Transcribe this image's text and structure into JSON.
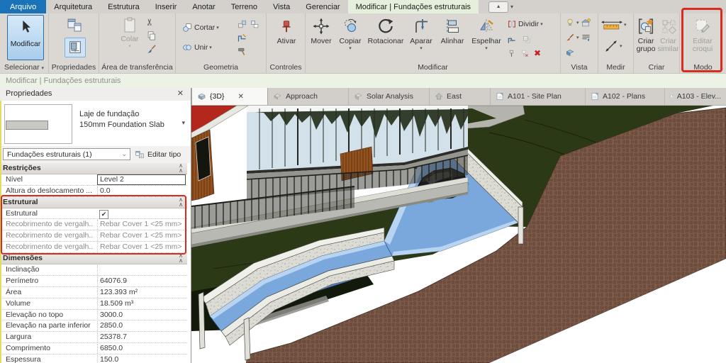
{
  "menu": {
    "items": [
      "Arquivo",
      "Arquitetura",
      "Estrutura",
      "Inserir",
      "Anotar",
      "Terreno",
      "Vista",
      "Gerenciar"
    ],
    "context_tab": "Modificar | Fundações estruturais"
  },
  "ribbon": {
    "modify_button": "Modificar",
    "panel_select": "Selecionar",
    "panel_properties": "Propriedades",
    "panel_clipboard": "Área de transferência",
    "panel_geometry": "Geometria",
    "panel_controls": "Controles",
    "panel_modify": "Modificar",
    "panel_view": "Vista",
    "panel_measure": "Medir",
    "panel_create": "Criar",
    "panel_mode": "Modo",
    "colar": "Colar",
    "cortar": "Cortar",
    "unir": "Unir",
    "ativar": "Ativar",
    "mover": "Mover",
    "copiar": "Copiar",
    "rotacionar": "Rotacionar",
    "aparar": "Aparar",
    "alinhar": "Alinhar",
    "espelhar": "Espelhar",
    "dividir": "Dividir",
    "criar_grupo": "Criar grupo",
    "criar_similar": "Criar similar",
    "editar_croqui": "Editar croqui"
  },
  "status_bar": {
    "text": "Modificar | Fundações estruturais"
  },
  "properties": {
    "title": "Propriedades",
    "close": "✕",
    "type_family": "Laje de fundação",
    "type_name": "150mm Foundation Slab",
    "selection": "Fundações estruturais (1)",
    "edit_type": "Editar tipo",
    "rows": [
      {
        "type": "section",
        "label": "Restrições"
      },
      {
        "type": "row",
        "label": "Nível",
        "value": "Level 2"
      },
      {
        "type": "row",
        "label": "Altura do deslocamento ...",
        "value": "0.0"
      },
      {
        "type": "section",
        "label": "Estrutural"
      },
      {
        "type": "check",
        "label": "Estrutural",
        "checked": "✔"
      },
      {
        "type": "row",
        "label": "Recobrimento de vergalh...",
        "value": "Rebar Cover 1 <25 mm>"
      },
      {
        "type": "row",
        "label": "Recobrimento de vergalh...",
        "value": "Rebar Cover 1 <25 mm>"
      },
      {
        "type": "row",
        "label": "Recobrimento de vergalh...",
        "value": "Rebar Cover 1 <25 mm>"
      },
      {
        "type": "section",
        "label": "Dimensões"
      },
      {
        "type": "row",
        "label": "Inclinação",
        "value": ""
      },
      {
        "type": "row",
        "label": "Perímetro",
        "value": "64076.9"
      },
      {
        "type": "row",
        "label": "Área",
        "value": "123.393 m²"
      },
      {
        "type": "row",
        "label": "Volume",
        "value": "18.509 m³"
      },
      {
        "type": "row",
        "label": "Elevação no topo",
        "value": "3000.0"
      },
      {
        "type": "row",
        "label": "Elevação na parte inferior",
        "value": "2850.0"
      },
      {
        "type": "row",
        "label": "Largura",
        "value": "25378.7"
      },
      {
        "type": "row",
        "label": "Comprimento",
        "value": "6850.0"
      },
      {
        "type": "row",
        "label": "Espessura",
        "value": "150.0"
      }
    ]
  },
  "view_tabs": {
    "tabs": [
      {
        "label": "{3D}",
        "active": true
      },
      {
        "label": "Approach",
        "active": false
      },
      {
        "label": "Solar Analysis",
        "active": false
      },
      {
        "label": "East",
        "active": false
      },
      {
        "label": "A101 - Site Plan",
        "active": false
      },
      {
        "label": "A102 - Plans",
        "active": false
      },
      {
        "label": "A103 - Elev...",
        "active": false
      }
    ]
  },
  "colors": {
    "annotation_red": "#d92b1f",
    "selection_blue": "#7aa7dc",
    "context_tab_green": "#e5f0dc",
    "active_file_tab_blue": "#1a72b8",
    "terrain_green": "#2c3917",
    "earth_brown": "#7e5a49"
  }
}
